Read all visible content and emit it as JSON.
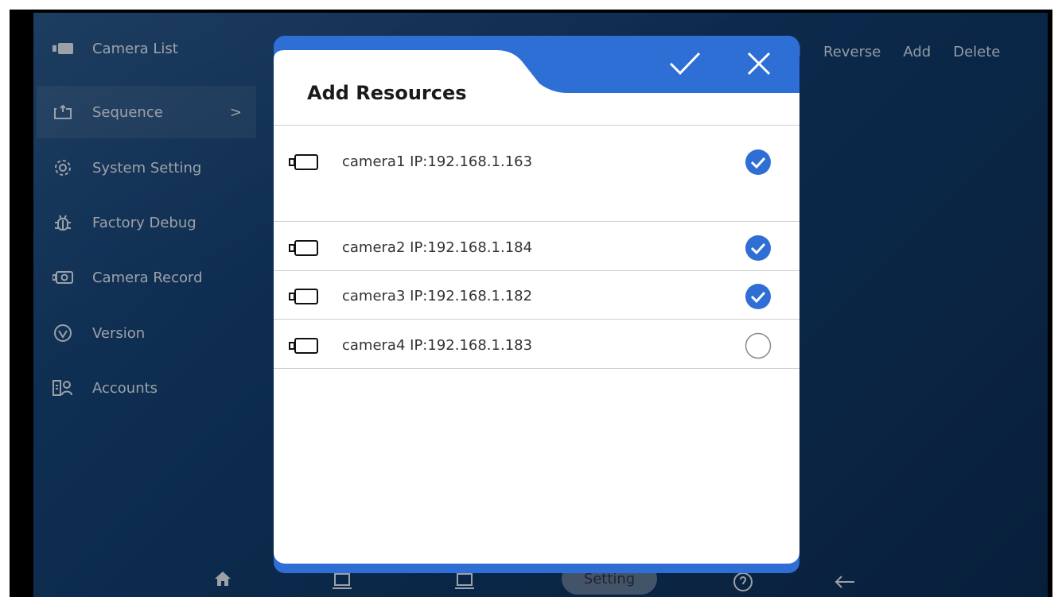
{
  "sidebar": {
    "items": [
      {
        "label": "Camera List",
        "icon": "camera-icon"
      },
      {
        "label": "Sequence",
        "icon": "sequence-icon",
        "active": true
      },
      {
        "label": "System Setting",
        "icon": "gear-icon"
      },
      {
        "label": "Factory Debug",
        "icon": "bug-icon"
      },
      {
        "label": "Camera Record",
        "icon": "record-icon"
      },
      {
        "label": "Version",
        "icon": "version-icon"
      },
      {
        "label": "Accounts",
        "icon": "accounts-icon"
      }
    ],
    "active_chevron": ">"
  },
  "top_actions": {
    "partial": "ll",
    "reverse": "Reverse",
    "add": "Add",
    "delete": "Delete"
  },
  "bottom_bar": {
    "setting": "Setting"
  },
  "dialog": {
    "title": "Add Resources",
    "accent": "#2f6ed4",
    "items": [
      {
        "label": "camera1 IP:192.168.1.163",
        "checked": true
      },
      {
        "label": "camera2 IP:192.168.1.184",
        "checked": true
      },
      {
        "label": "camera3 IP:192.168.1.182",
        "checked": true
      },
      {
        "label": "camera4 IP:192.168.1.183",
        "checked": false
      }
    ]
  }
}
